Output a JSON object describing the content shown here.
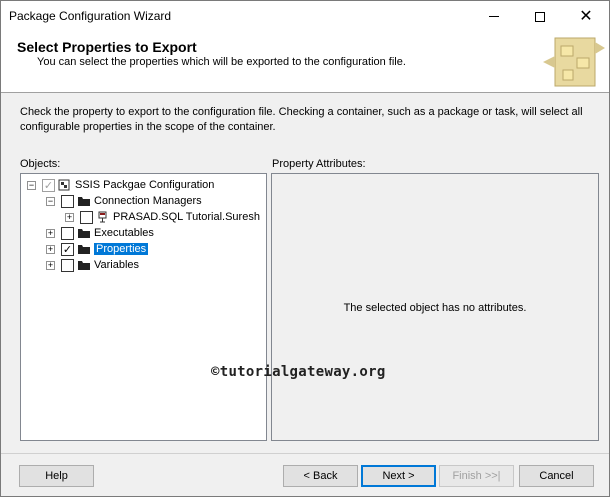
{
  "window": {
    "title": "Package Configuration Wizard"
  },
  "header": {
    "title": "Select Properties to Export",
    "subtitle": "You can select the properties which will be exported to the configuration file."
  },
  "description": "Check the property to export to the configuration file. Checking a container, such as a package or task, will select all configurable properties in the scope of the container.",
  "objects": {
    "label": "Objects:",
    "tree": [
      {
        "label": "SSIS Packgae Configuration",
        "expander": "−",
        "checked": true,
        "gray": true,
        "icon": "package-icon"
      },
      {
        "label": "Connection Managers",
        "expander": "−",
        "checked": false,
        "icon": "folder-icon"
      },
      {
        "label": "PRASAD.SQL Tutorial.Suresh",
        "expander": "+",
        "checked": false,
        "icon": "connection-icon"
      },
      {
        "label": "Executables",
        "expander": "+",
        "checked": false,
        "icon": "folder-icon"
      },
      {
        "label": "Properties",
        "expander": "+",
        "checked": true,
        "selected": true,
        "icon": "folder-icon"
      },
      {
        "label": "Variables",
        "expander": "+",
        "checked": false,
        "icon": "folder-icon"
      }
    ]
  },
  "attributes": {
    "label": "Property Attributes:",
    "empty_message": "The selected object has no attributes."
  },
  "watermark": "©tutorialgateway.org",
  "buttons": {
    "help": "Help",
    "back": "< Back",
    "next": "Next >",
    "finish": "Finish >>|",
    "cancel": "Cancel"
  },
  "check_mark": "✓",
  "accent_color": "#0078d7"
}
